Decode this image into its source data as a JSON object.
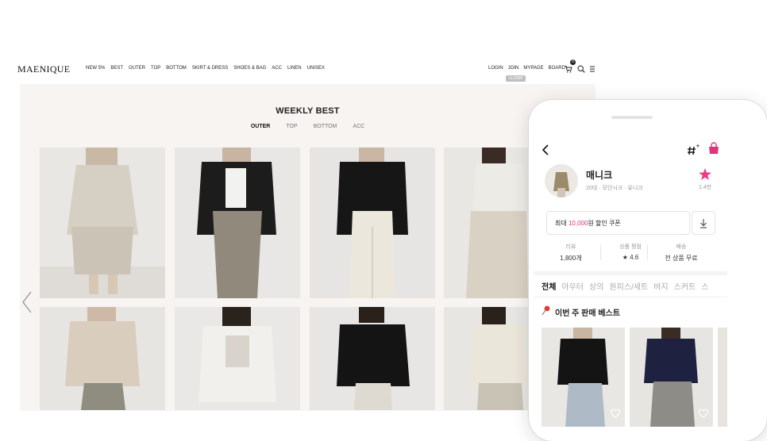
{
  "site": {
    "logo": "MAENIQUE",
    "menu": [
      "NEW 5%",
      "BEST",
      "OUTER",
      "TOP",
      "BOTTOM",
      "SKIRT & DRESS",
      "SHOES & BAG",
      "ACC",
      "LINEN",
      "UNISEX"
    ],
    "util": [
      "LOGIN",
      "JOIN",
      "MYPAGE",
      "BOARD"
    ],
    "join_coupon": "+2,000P",
    "cart_count": "0"
  },
  "hero": {
    "title": "WEEKLY BEST",
    "tabs": [
      "OUTER",
      "TOP",
      "BOTTOM",
      "ACC"
    ]
  },
  "app": {
    "shop_name": "매니크",
    "shop_tags": "20대 · 모던시크 · 유니크",
    "fav_count": "1.4만",
    "coupon": {
      "prefix": "최대 ",
      "amount": "10,000",
      "suffix": "원 할인 쿠폰"
    },
    "stats": [
      {
        "label": "리뷰",
        "value": "1,800개"
      },
      {
        "label": "상품 평점",
        "value": "★ 4.6"
      },
      {
        "label": "배송",
        "value": "전 상품 무료"
      }
    ],
    "categories": [
      "전체",
      "아우터",
      "상의",
      "원피스/세트",
      "바지",
      "스커트",
      "스"
    ],
    "best_title": "이번 주 판매 베스트"
  },
  "colors": {
    "accent_pink": "#e3337c",
    "hero_bg": "#f7f4f2"
  }
}
